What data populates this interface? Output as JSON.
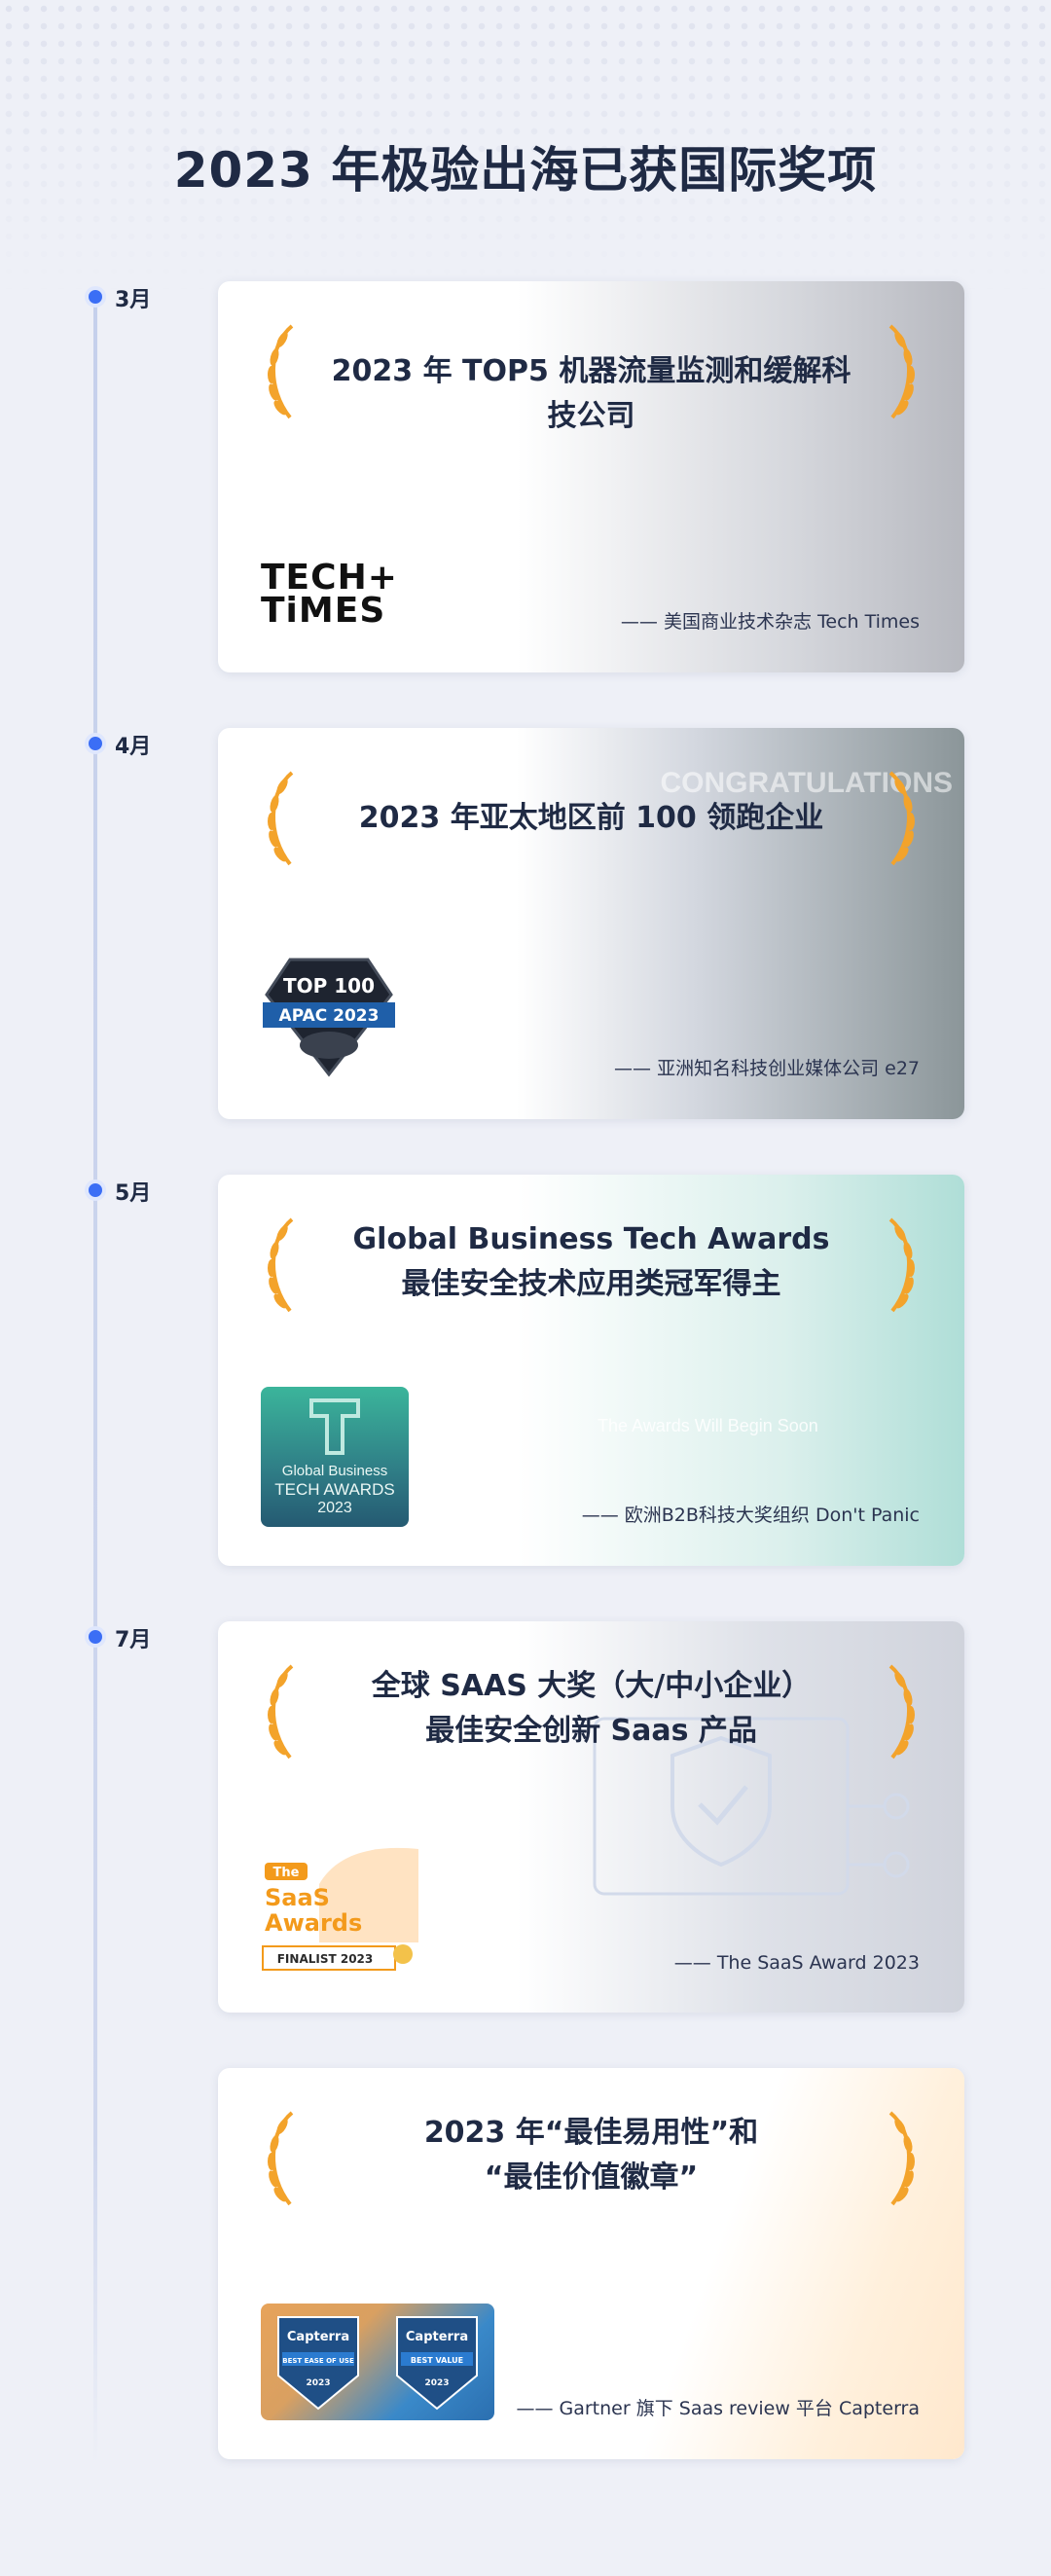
{
  "page_title": "2023 年极验出海已获国际奖项",
  "colors": {
    "accent": "#3b6ef5",
    "laurel": "#f3a32b",
    "title": "#1f2a44"
  },
  "timeline": [
    {
      "month": "3月",
      "title_lines": [
        "2023 年 TOP5 机器流量监测和缓解科技公司"
      ],
      "source": "—— 美国商业技术杂志 Tech Times",
      "logo": {
        "icon": "tech-times-logo",
        "text_line1": "TECH+",
        "text_line2": "TiMES"
      }
    },
    {
      "month": "4月",
      "title_lines": [
        "2023 年亚太地区前 100 领跑企业"
      ],
      "source": "—— 亚洲知名科技创业媒体公司 e27",
      "logo": {
        "icon": "top100-apac-badge",
        "text_line1": "TOP 100",
        "text_line2": "APAC 2023"
      },
      "background_text": "CONGRATULATIONS"
    },
    {
      "month": "5月",
      "title_lines": [
        "Global Business Tech Awards",
        "最佳安全技术应用类冠军得主"
      ],
      "source": "—— 欧洲B2B科技大奖组织 Don't Panic",
      "logo": {
        "icon": "global-business-tech-awards-logo",
        "text_line1": "Global Business",
        "text_line2": "TECH AWARDS",
        "text_line3": "2023"
      },
      "background_text": "The Awards Will Begin Soon"
    },
    {
      "month": "7月",
      "title_lines": [
        "全球 SAAS 大奖（大/中小企业）",
        "最佳安全创新 Saas 产品"
      ],
      "source": "—— The SaaS Award 2023",
      "logo": {
        "icon": "saas-awards-logo",
        "text_line1": "The",
        "text_line2": "SaaS",
        "text_line3": "Awards",
        "text_line4": "FINALIST 2023"
      }
    },
    {
      "month": "",
      "title_lines": [
        "2023 年“最佳易用性”和",
        "“最佳价值徽章”"
      ],
      "source": "—— Gartner 旗下 Saas review 平台 Capterra",
      "logo": {
        "icon": "capterra-badges-logo",
        "badge1_brand": "Capterra",
        "badge1_label": "BEST EASE OF USE",
        "badge1_year": "2023",
        "badge2_brand": "Capterra",
        "badge2_label": "BEST VALUE",
        "badge2_year": "2023"
      }
    }
  ]
}
